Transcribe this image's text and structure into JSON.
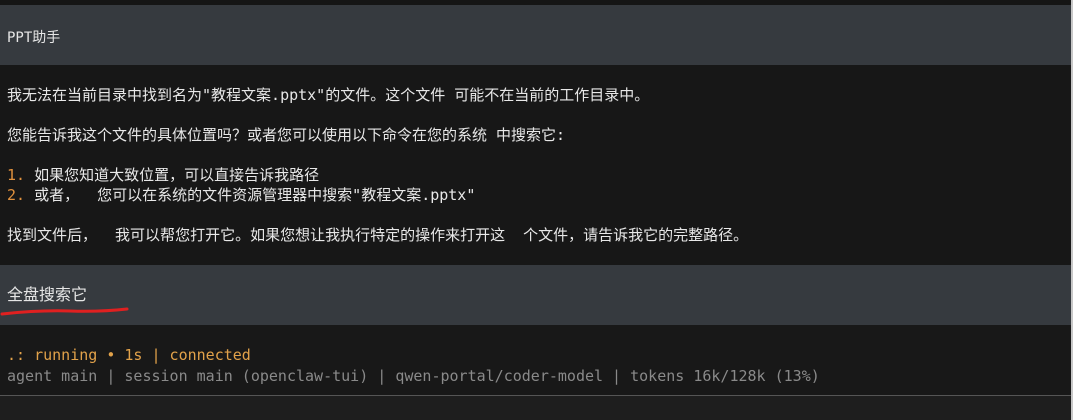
{
  "messages": {
    "user1": "PPT助手",
    "assistant": {
      "line1": "我无法在当前目录中找到名为\"教程文案.pptx\"的文件。这个文件 可能不在当前的工作目录中。",
      "line2": "您能告诉我这个文件的具体位置吗？或者您可以使用以下命令在您的系统 中搜索它:",
      "items": [
        {
          "num": "1.",
          "text": " 如果您知道大致位置，可以直接告诉我路径"
        },
        {
          "num": "2.",
          "text": " 或者，  您可以在系统的文件资源管理器中搜索\"教程文案.pptx\""
        }
      ],
      "line5": "找到文件后，  我可以帮您打开它。如果您想让我执行特定的操作来打开这  个文件，请告诉我它的完整路径。"
    },
    "user2": "全盘搜索它"
  },
  "status": {
    "line": ".: running • 1s | connected",
    "info": "agent main | session main (openclaw-tui) | qwen-portal/coder-model | tokens 16k/128k (13%)"
  },
  "annotation_color": "#e02020"
}
